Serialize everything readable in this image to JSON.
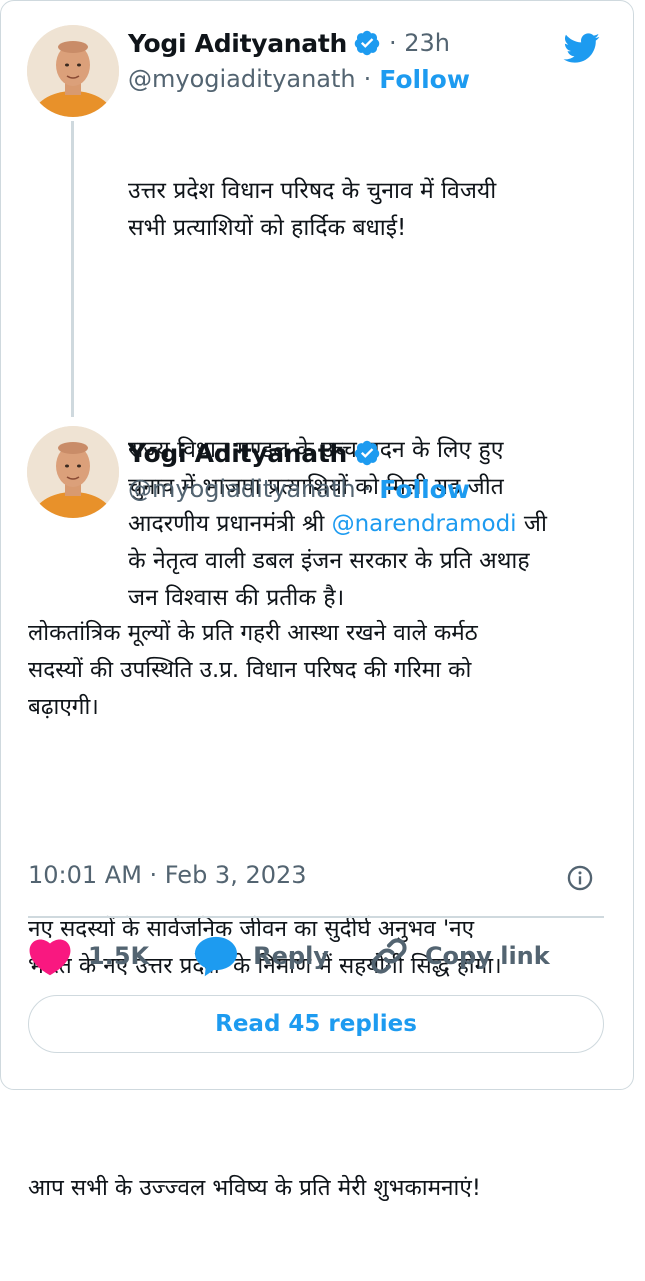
{
  "tweet1": {
    "name": "Yogi Adityanath",
    "time": "· 23h",
    "handle": "@myogiadityanath",
    "separator": "·",
    "follow": "Follow",
    "para1": "उत्तर प्रदेश विधान परिषद के चुनाव में विजयी\nसभी प्रत्याशियों को हार्दिक बधाई!",
    "para2_part1": "राज्य विधान मण्डल के उच्च सदन के लिए हुए\nचुनाव में भाजपा प्रत्याशियों को मिली यह जीत\nआदरणीय प्रधानमंत्री श्री ",
    "mention": "@narendramodi",
    "para2_part2": " जी\nके नेतृत्व वाली डबल इंजन सरकार के प्रति अथाह\nजन विश्वास की प्रतीक है।"
  },
  "tweet2": {
    "name": "Yogi Adityanath",
    "handle": "@myogiadityanath",
    "separator": "·",
    "follow": "Follow",
    "para1": "लोकतांत्रिक मूल्यों के प्रति गहरी आस्था रखने वाले कर्मठ\nसदस्यों की उपस्थिति उ.प्र. विधान परिषद की गरिमा को\nबढ़ाएगी।",
    "para2": "नए सदस्यों के सार्वजनिक जीवन का सुदीर्घ अनुभव 'नए\nभारत के नए उत्तर प्रदेश' के निर्माण में सहयोगी सिद्ध होगा।",
    "para3": "आप सभी के उज्ज्वल भविष्य के प्रति मेरी शुभकामनाएं!",
    "timestamp": "10:01 AM · Feb 3, 2023"
  },
  "actions": {
    "like_count": "1.5K",
    "reply_label": "Reply",
    "copy_label": "Copy link"
  },
  "read_replies": "Read 45 replies",
  "icons": {
    "brand": "twitter-bird-icon",
    "verified": "verified-badge-icon",
    "like": "heart-icon",
    "reply": "speech-bubble-icon",
    "copy": "link-icon",
    "info": "info-icon"
  },
  "colors": {
    "accent": "#1d9bf0",
    "like": "#f91880",
    "muted": "#536471",
    "border": "#cfd9de"
  }
}
